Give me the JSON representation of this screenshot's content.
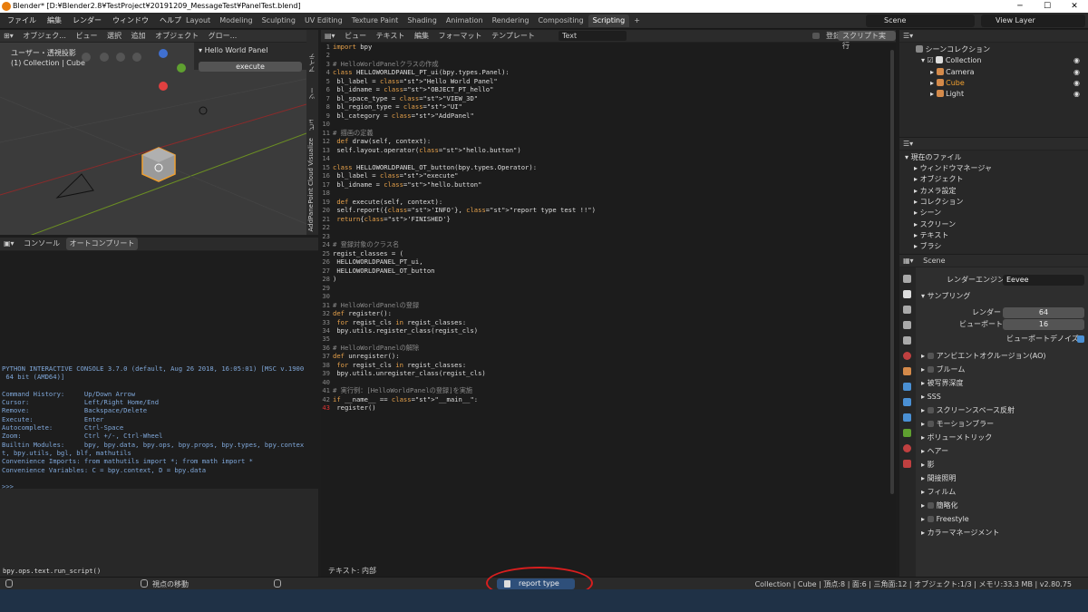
{
  "window": {
    "title": "Blender* [D:¥Blender2.8¥TestProject¥20191209_MessageTest¥PanelTest.blend]"
  },
  "menu": [
    "ファイル",
    "編集",
    "レンダー",
    "ウィンドウ",
    "ヘルプ"
  ],
  "workspaces": [
    "Layout",
    "Modeling",
    "Sculpting",
    "UV Editing",
    "Texture Paint",
    "Shading",
    "Animation",
    "Rendering",
    "Compositing",
    "Scripting"
  ],
  "active_workspace": "Scripting",
  "scene_name": "Scene",
  "view_layer": "View Layer",
  "viewport": {
    "header": [
      "オブジェク...",
      "ビュー",
      "選択",
      "追加",
      "オブジェクト",
      "グロー..."
    ],
    "view_label": "ユーザー・透視投影",
    "collection_label": "(1) Collection | Cube",
    "panel_title": "Hello World Panel",
    "execute_button": "execute"
  },
  "side_tabs": [
    "アイテ",
    "ツー",
    "ビュ",
    "Point Cloud Visualize",
    "AddPane"
  ],
  "console": {
    "tabs": [
      "コンソール",
      "オートコンプリート"
    ],
    "lines": [
      "PYTHON INTERACTIVE CONSOLE 3.7.0 (default, Aug 26 2018, 16:05:01) [MSC v.1900",
      " 64 bit (AMD64)]",
      "",
      "Command History:     Up/Down Arrow",
      "Cursor:              Left/Right Home/End",
      "Remove:              Backspace/Delete",
      "Execute:             Enter",
      "Autocomplete:        Ctrl-Space",
      "Zoom:                Ctrl +/-, Ctrl-Wheel",
      "Builtin Modules:     bpy, bpy.data, bpy.ops, bpy.props, bpy.types, bpy.contex",
      "t, bpy.utils, bgl, blf, mathutils",
      "Convenience Imports: from mathutils import *; from math import *",
      "Convenience Variables: C = bpy.context, D = bpy.data",
      "",
      ">>> "
    ]
  },
  "info_log": "bpy.ops.text.run_script()",
  "text_editor": {
    "header": [
      "ビュー",
      "テキスト",
      "編集",
      "フォーマット",
      "テンプレート"
    ],
    "text_name": "Text",
    "register_label": "登録",
    "run_button": "スクリプト実行",
    "footer": "テキスト: 内部",
    "code": [
      [
        "import bpy"
      ],
      [
        ""
      ],
      [
        "# HelloWorldPanelクラスの作成"
      ],
      [
        "class HELLOWORLDPANEL_PT_ui(bpy.types.Panel):"
      ],
      [
        "    bl_label = \"Hello World Panel\""
      ],
      [
        "    bl_idname = \"OBJECT_PT_hello\""
      ],
      [
        "    bl_space_type = \"VIEW_3D\""
      ],
      [
        "    bl_region_type = \"UI\""
      ],
      [
        "    bl_category = \"AddPanel\""
      ],
      [
        ""
      ],
      [
        "# 描画の定義"
      ],
      [
        "    def draw(self, context):"
      ],
      [
        "        self.layout.operator(\"hello.button\")"
      ],
      [
        ""
      ],
      [
        "class HELLOWORLDPANEL_OT_button(bpy.types.Operator):"
      ],
      [
        "    bl_label = \"execute\""
      ],
      [
        "    bl_idname = \"hello.button\""
      ],
      [
        ""
      ],
      [
        "    def execute(self, context):"
      ],
      [
        "        self.report({'INFO'}, \"report type test !!\")"
      ],
      [
        "        return{'FINISHED'}"
      ],
      [
        ""
      ],
      [
        ""
      ],
      [
        "# 登録対象のクラス名"
      ],
      [
        "regist_classes = ("
      ],
      [
        "    HELLOWORLDPANEL_PT_ui,"
      ],
      [
        "    HELLOWORLDPANEL_OT_button"
      ],
      [
        ")"
      ],
      [
        ""
      ],
      [
        ""
      ],
      [
        "# HelloWorldPanelの登録"
      ],
      [
        "def register():"
      ],
      [
        "    for regist_cls in regist_classes:"
      ],
      [
        "        bpy.utils.register_class(regist_cls)"
      ],
      [
        ""
      ],
      [
        "# HelloWorldPanelの解除"
      ],
      [
        "def unregister():"
      ],
      [
        "    for regist_cls in regist_classes:"
      ],
      [
        "        bpy.utils.unregister_class(regist_cls)"
      ],
      [
        ""
      ],
      [
        "# 実行例：[HelloWorldPanelの登録]を実施"
      ],
      [
        "if __name__ == \"__main__\":"
      ],
      [
        "    register()"
      ]
    ]
  },
  "outliner": {
    "title": "シーンコレクション",
    "items": [
      "Collection",
      "Camera",
      "Cube",
      "Light"
    ]
  },
  "file_view": {
    "title": "現在のファイル",
    "items": [
      "ウィンドウマネージャ",
      "オブジェクト",
      "カメラ設定",
      "コレクション",
      "シーン",
      "スクリーン",
      "テキスト",
      "ブラシ"
    ]
  },
  "properties": {
    "scene": "Scene",
    "render_engine_label": "レンダーエンジン",
    "render_engine": "Eevee",
    "sampling": "サンプリング",
    "render_label": "レンダー",
    "render_value": "64",
    "viewport_label": "ビューポート",
    "viewport_value": "16",
    "denoise": "ビューポートデノイズ",
    "sections": [
      "アンビエントオクルージョン(AO)",
      "ブルーム",
      "被写界深度",
      "SSS",
      "スクリーンスペース反射",
      "モーションブラー",
      "ボリューメトリック",
      "ヘアー",
      "影",
      "間接照明",
      "フィルム",
      "簡略化",
      "Freestyle",
      "カラーマネージメント"
    ]
  },
  "status": {
    "left": "視点の移動",
    "report": "report type test !!",
    "right": "Collection | Cube | 頂点:8 | 面:6 | 三角面:12 | オブジェクト:1/3 | メモリ:33.3 MB | v2.80.75"
  }
}
